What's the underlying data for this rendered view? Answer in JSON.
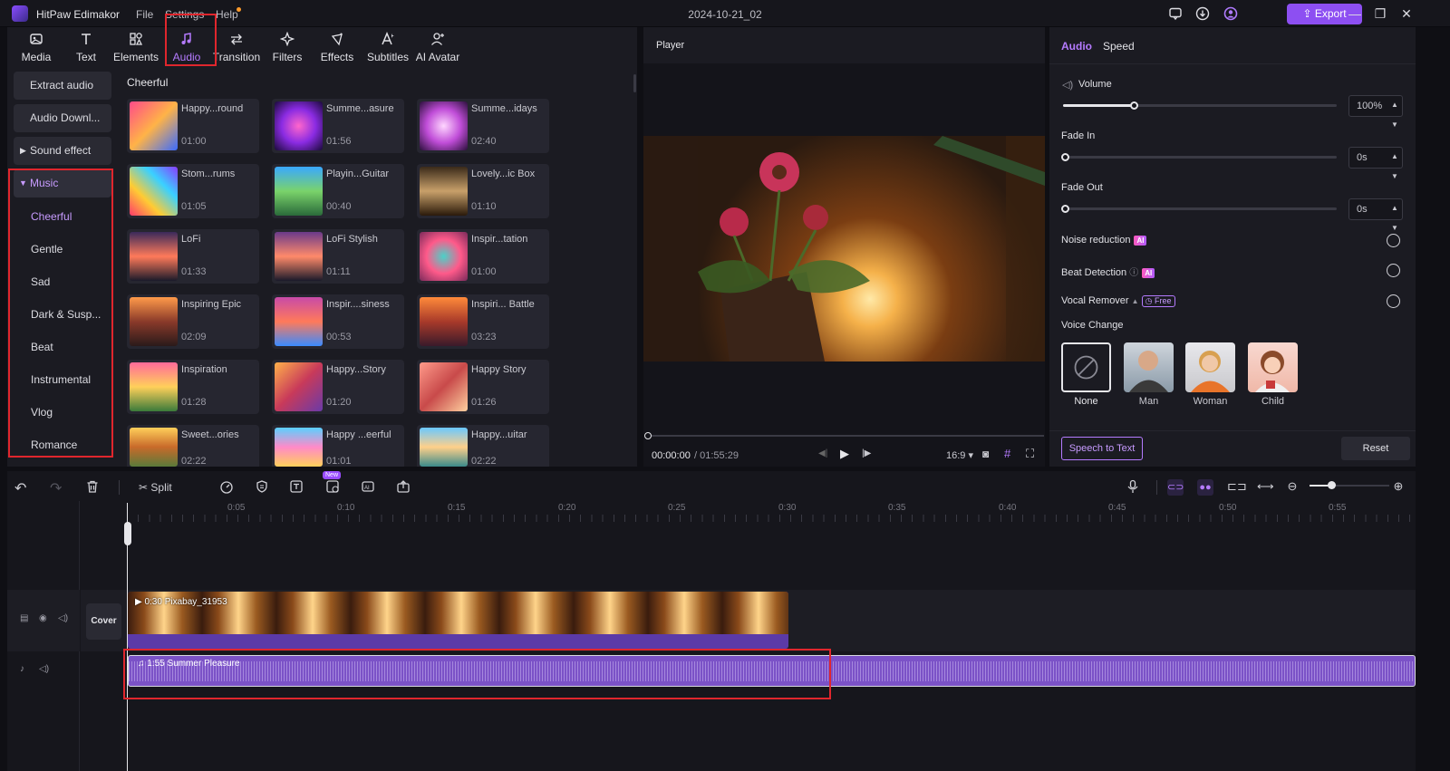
{
  "app": {
    "title": "HitPaw Edimakor",
    "project": "2024-10-21_02",
    "menus": [
      "File",
      "Settings",
      "Help"
    ],
    "export_label": "Export"
  },
  "toolbar": [
    {
      "label": "Media",
      "icon": "media-icon"
    },
    {
      "label": "Text",
      "icon": "text-icon"
    },
    {
      "label": "Elements",
      "icon": "elements-icon"
    },
    {
      "label": "Audio",
      "icon": "music-note-icon"
    },
    {
      "label": "Transition",
      "icon": "transition-icon"
    },
    {
      "label": "Filters",
      "icon": "filters-icon"
    },
    {
      "label": "Effects",
      "icon": "effects-icon"
    },
    {
      "label": "Subtitles",
      "icon": "subtitles-icon"
    },
    {
      "label": "AI Avatar",
      "icon": "ai-avatar-icon"
    }
  ],
  "sidebar": {
    "buttons": [
      "Extract audio",
      "Audio Downl...",
      "Sound effect",
      "Music"
    ],
    "music_subcategories": [
      "Cheerful",
      "Gentle",
      "Sad",
      "Dark & Susp...",
      "Beat",
      "Instrumental",
      "Vlog",
      "Romance"
    ]
  },
  "library": {
    "section_title": "Cheerful",
    "items": [
      {
        "name": "Happy...round",
        "duration": "01:00"
      },
      {
        "name": "Summe...asure",
        "duration": "01:56"
      },
      {
        "name": "Summe...idays",
        "duration": "02:40"
      },
      {
        "name": "Stom...rums",
        "duration": "01:05"
      },
      {
        "name": "Playin...Guitar",
        "duration": "00:40"
      },
      {
        "name": "Lovely...ic Box",
        "duration": "01:10"
      },
      {
        "name": "LoFi",
        "duration": "01:33"
      },
      {
        "name": "LoFi Stylish",
        "duration": "01:11"
      },
      {
        "name": "Inspir...tation",
        "duration": "01:00"
      },
      {
        "name": "Inspiring Epic",
        "duration": "02:09"
      },
      {
        "name": "Inspir....siness",
        "duration": "00:53"
      },
      {
        "name": "Inspiri... Battle",
        "duration": "03:23"
      },
      {
        "name": "Inspiration",
        "duration": "01:28"
      },
      {
        "name": "Happy...Story",
        "duration": "01:20"
      },
      {
        "name": "Happy Story",
        "duration": "01:26"
      },
      {
        "name": "Sweet...ories",
        "duration": "02:22"
      },
      {
        "name": "Happy ...eerful",
        "duration": "01:01"
      },
      {
        "name": "Happy...uitar",
        "duration": "02:22"
      }
    ]
  },
  "player": {
    "title": "Player",
    "current_time": "00:00:00",
    "total_time": "/ 01:55:29",
    "aspect": "16:9",
    "progress": 0
  },
  "audio_panel": {
    "tabs": [
      "Audio",
      "Speed"
    ],
    "volume_label": "Volume",
    "volume_value": "100%",
    "volume_level": 0.26,
    "fade_in_label": "Fade In",
    "fade_in_value": "0s",
    "fade_out_label": "Fade Out",
    "fade_out_value": "0s",
    "noise_reduction": "Noise reduction",
    "beat_detection": "Beat Detection",
    "vocal_remover": "Vocal Remover",
    "free_badge": "Free",
    "ai_badge": "AI",
    "voice_change_label": "Voice Change",
    "voices": [
      "None",
      "Man",
      "Woman",
      "Child"
    ],
    "speech_to_text": "Speech to Text",
    "reset": "Reset"
  },
  "timeline": {
    "split_label": "Split",
    "new_badge": "New",
    "ticks": [
      "0:05",
      "0:10",
      "0:15",
      "0:20",
      "0:25",
      "0:30",
      "0:35",
      "0:40",
      "0:45",
      "0:50",
      "0:55"
    ],
    "cover_label": "Cover",
    "video_clip": "0:30 Pixabay_31953",
    "audio_clip": "1:55 Summer Pleasure"
  },
  "colors": {
    "accent": "#8d4ff2",
    "highlight": "#e0262d",
    "audio_track": "#7b52c7"
  }
}
